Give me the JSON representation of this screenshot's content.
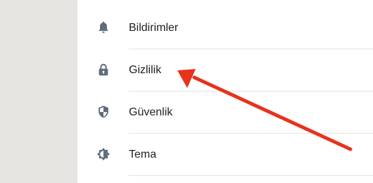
{
  "menu": {
    "items": [
      {
        "label": "Bildirimler",
        "icon": "bell-icon"
      },
      {
        "label": "Gizlilik",
        "icon": "lock-icon"
      },
      {
        "label": "Güvenlik",
        "icon": "shield-icon"
      },
      {
        "label": "Tema",
        "icon": "theme-icon"
      }
    ]
  },
  "colors": {
    "icon": "#5f6b7a",
    "text": "#222222",
    "divider": "#e3e3e3",
    "gutter": "#e6e5e2",
    "annotation_arrow": "#e8321e"
  },
  "annotation": {
    "type": "arrow",
    "target": "menu-item-privacy"
  }
}
